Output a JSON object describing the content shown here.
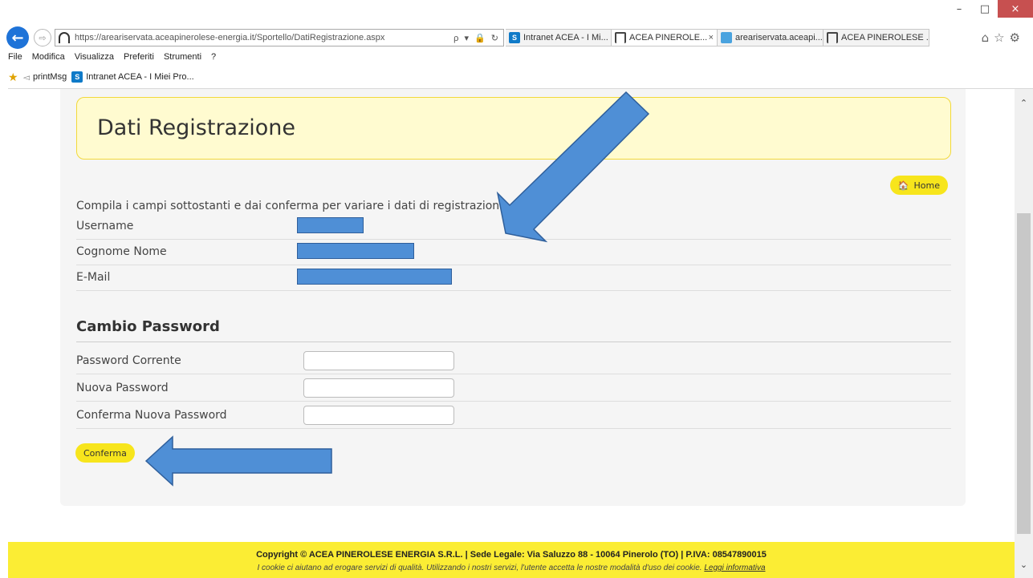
{
  "browser": {
    "url": "https://areariservata.aceapinerolese-energia.it/Sportello/DatiRegistrazione.aspx",
    "address_tools": "ρ ▾ 🔒 ↻",
    "tabs": [
      {
        "label": "Intranet ACEA - I Mi...",
        "icon": "sharepoint-icon"
      },
      {
        "label": "ACEA PINEROLE...",
        "icon": "acea-logo-icon",
        "close": "×"
      },
      {
        "label": "areariservata.aceapi...",
        "icon": "ie-icon"
      },
      {
        "label": "ACEA PINEROLESE ...",
        "icon": "acea-logo-icon"
      }
    ],
    "menu": [
      "File",
      "Modifica",
      "Visualizza",
      "Preferiti",
      "Strumenti",
      "?"
    ],
    "favorites": [
      {
        "label": "printMsg"
      },
      {
        "label": "Intranet ACEA - I Miei Pro..."
      }
    ],
    "window_controls": {
      "minimize": "–",
      "maximize": "□",
      "close": "×"
    }
  },
  "page": {
    "title": "Dati Registrazione",
    "home_label": "Home",
    "intro": "Compila i campi sottostanti e dai conferma per variare i dati di registrazione.",
    "fields": [
      {
        "label": "Username"
      },
      {
        "label": "Cognome Nome"
      },
      {
        "label": "E-Mail"
      }
    ],
    "section_title": "Cambio Password",
    "password_fields": [
      {
        "label": "Password Corrente",
        "value": ""
      },
      {
        "label": "Nuova Password",
        "value": ""
      },
      {
        "label": "Conferma Nuova Password",
        "value": ""
      }
    ],
    "confirm_label": "Conferma"
  },
  "footer": {
    "line1": "Copyright © ACEA PINEROLESE ENERGIA S.R.L.  | Sede Legale: Via Saluzzo 88 - 10064 Pinerolo (TO) | P.IVA: 08547890015",
    "line2": "I cookie ci aiutano ad erogare servizi di qualità. Utilizzando i nostri servizi, l'utente accetta le nostre modalità d'uso dei cookie.",
    "link": "Leggi informativa"
  },
  "colors": {
    "accent_yellow": "#f7e51c",
    "annotation_blue": "#4f8fd6"
  }
}
